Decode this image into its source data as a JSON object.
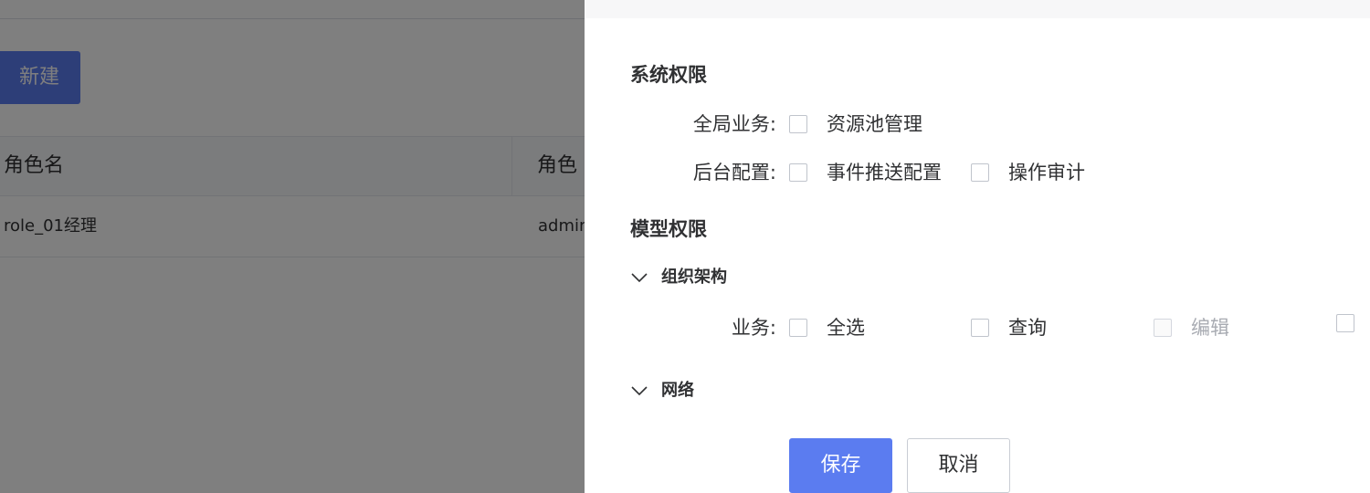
{
  "background": {
    "new_button": "新建",
    "table": {
      "headers": [
        "角色名",
        "角色"
      ],
      "rows": [
        [
          "role_01经理",
          "admin"
        ]
      ]
    }
  },
  "drawer": {
    "system_permissions": {
      "title": "系统权限",
      "global_business": {
        "label": "全局业务:",
        "options": [
          {
            "label": "资源池管理",
            "checked": false,
            "disabled": false
          }
        ]
      },
      "backend_config": {
        "label": "后台配置:",
        "options": [
          {
            "label": "事件推送配置",
            "checked": false,
            "disabled": false
          },
          {
            "label": "操作审计",
            "checked": false,
            "disabled": false
          }
        ]
      }
    },
    "model_permissions": {
      "title": "模型权限",
      "groups": [
        {
          "name": "组织架构",
          "expanded": true,
          "business": {
            "label": "业务:",
            "options": [
              {
                "label": "全选",
                "checked": false,
                "disabled": false
              },
              {
                "label": "查询",
                "checked": false,
                "disabled": false
              },
              {
                "label": "编辑",
                "checked": false,
                "disabled": true
              },
              {
                "label": "",
                "checked": false,
                "disabled": false
              }
            ]
          }
        },
        {
          "name": "网络",
          "expanded": true
        }
      ]
    },
    "buttons": {
      "save": "保存",
      "cancel": "取消"
    }
  },
  "colors": {
    "primary": "#5b7cf0",
    "mask": "rgba(0,0,0,0.5)",
    "text": "#303133",
    "disabled_text": "#a8abb2"
  }
}
